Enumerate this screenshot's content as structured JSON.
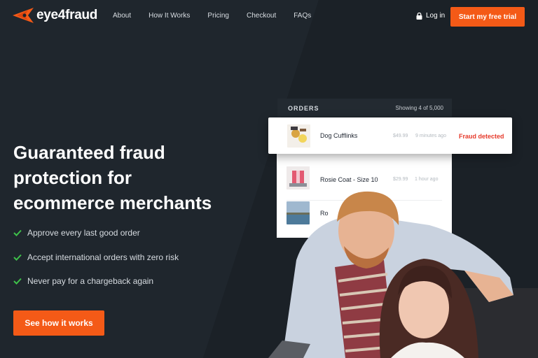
{
  "brand": {
    "name": "eye4fraud",
    "accent": "#f45a17"
  },
  "nav": {
    "links": [
      "About",
      "How It Works",
      "Pricing",
      "Checkout",
      "FAQs"
    ],
    "login_label": "Log in",
    "cta_label": "Start my free trial"
  },
  "hero": {
    "headline_lines": [
      "Guaranteed fraud",
      "protection for",
      "ecommerce merchants"
    ],
    "benefits": [
      "Approve every last good order",
      "Accept international orders with zero risk",
      "Never pay for a chargeback again"
    ],
    "cta_label": "See how it works"
  },
  "orders": {
    "title": "ORDERS",
    "count": "Showing 4 of 5,000",
    "items": [
      {
        "name": "Dog Cufflinks",
        "price": "$49.99",
        "time": "9 minutes ago",
        "status": "Fraud detected"
      },
      {
        "name": "Rosie Coat - Size 10",
        "price": "$29.99",
        "time": "1 hour ago"
      },
      {
        "name": "Ro",
        "price": "",
        "time": ""
      }
    ]
  },
  "icons": {
    "logo": "eye-logo-icon",
    "lock": "lock-icon",
    "check": "check-icon"
  },
  "colors": {
    "fraud": "#e63a2b",
    "check": "#3ec14a",
    "background": "#1d2329"
  }
}
